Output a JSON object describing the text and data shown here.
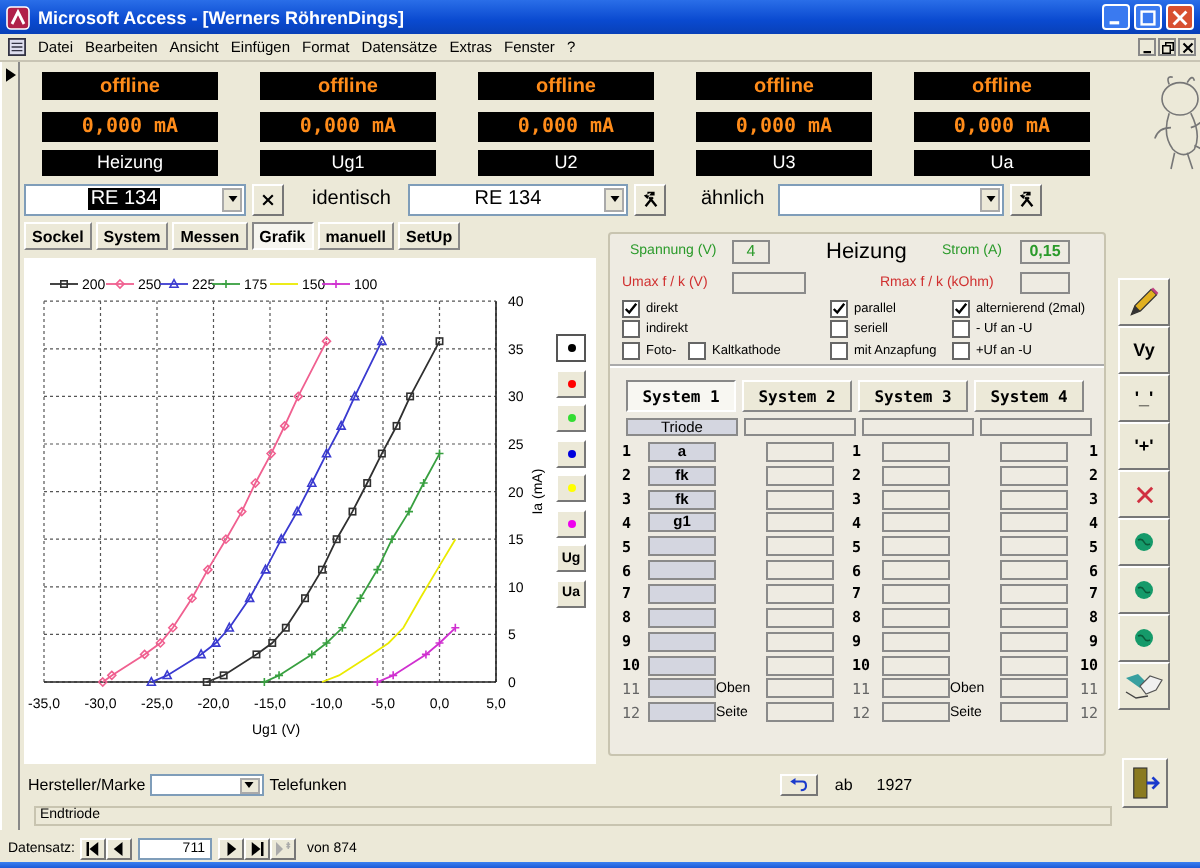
{
  "window": {
    "title": "Microsoft Access - [Werners RöhrenDings]"
  },
  "menu": [
    "Datei",
    "Bearbeiten",
    "Ansicht",
    "Einfügen",
    "Format",
    "Datensätze",
    "Extras",
    "Fenster",
    "?"
  ],
  "meters": [
    {
      "status": "offline",
      "reading": "0,000 mA",
      "label": "Heizung"
    },
    {
      "status": "offline",
      "reading": "0,000 mA",
      "label": "Ug1"
    },
    {
      "status": "offline",
      "reading": "0,000 mA",
      "label": "U2"
    },
    {
      "status": "offline",
      "reading": "0,000 mA",
      "label": "U3"
    },
    {
      "status": "offline",
      "reading": "0,000 mA",
      "label": "Ua"
    }
  ],
  "tube_selector": {
    "value": "RE 134",
    "highlighted": true
  },
  "identical": {
    "label": "identisch",
    "value": "RE 134"
  },
  "similar": {
    "label": "ähnlich"
  },
  "tabs": [
    {
      "label": "Sockel",
      "selected": false
    },
    {
      "label": "System",
      "selected": false
    },
    {
      "label": "Messen",
      "selected": false
    },
    {
      "label": "Grafik",
      "selected": true
    },
    {
      "label": "manuell",
      "selected": false
    },
    {
      "label": "SetUp",
      "selected": false
    }
  ],
  "chart_panel": {
    "chart_data": {
      "type": "line",
      "grid": true,
      "legend": true,
      "xlabel": "Ug1 (V)",
      "ylabel": "Ia (mA)",
      "xlim": [
        -35,
        5
      ],
      "ylim": [
        0,
        40
      ],
      "xticks": [
        {
          "value": -35,
          "label": "-35,0"
        },
        {
          "value": -30,
          "label": "-30,0"
        },
        {
          "value": -25,
          "label": "-25,0"
        },
        {
          "value": -20,
          "label": "-20,0"
        },
        {
          "value": -15,
          "label": "-15,0"
        },
        {
          "value": -10,
          "label": "-10,0"
        },
        {
          "value": -5,
          "label": "-5,0"
        },
        {
          "value": 0,
          "label": "0,0"
        },
        {
          "value": 5,
          "label": "5,0"
        }
      ],
      "yticks": [
        0,
        5,
        10,
        15,
        20,
        25,
        30,
        35,
        40
      ],
      "series": [
        {
          "name": "200",
          "color": "#303030",
          "marker": "square",
          "x": [
            -20.6,
            -19.1,
            -16.2,
            -14.8,
            -13.6,
            -11.9,
            -10.4,
            -9.1,
            -7.7,
            -6.4,
            -5.1,
            -3.8,
            -2.6,
            0
          ],
          "values": [
            0,
            0.7,
            2.9,
            4.1,
            5.7,
            8.8,
            11.8,
            15,
            17.9,
            20.9,
            24,
            26.9,
            30,
            35.8
          ]
        },
        {
          "name": "250",
          "color": "#f06090",
          "marker": "diamond",
          "x": [
            -29.8,
            -29,
            -26.1,
            -24.7,
            -23.6,
            -21.9,
            -20.5,
            -18.9,
            -17.5,
            -16.3,
            -14.9,
            -13.7,
            -12.5,
            -10
          ],
          "values": [
            0,
            0.7,
            2.9,
            4.1,
            5.7,
            8.8,
            11.8,
            15,
            17.9,
            20.9,
            24,
            26.9,
            30,
            35.8
          ]
        },
        {
          "name": "225",
          "color": "#3a3ad0",
          "marker": "triangle",
          "x": [
            -25.5,
            -24.1,
            -21.1,
            -19.8,
            -18.6,
            -16.8,
            -15.4,
            -14,
            -12.6,
            -11.3,
            -10,
            -8.7,
            -7.5,
            -5.1
          ],
          "values": [
            0,
            0.7,
            2.9,
            4.1,
            5.7,
            8.8,
            11.8,
            15,
            17.9,
            20.9,
            24,
            26.9,
            30,
            35.8
          ]
        },
        {
          "name": "175",
          "color": "#38a040",
          "marker": "cross",
          "x": [
            -15.5,
            -14.2,
            -11.3,
            -10,
            -8.6,
            -7,
            -5.5,
            -4.2,
            -2.7,
            -1.4,
            0
          ],
          "values": [
            0,
            0.7,
            2.9,
            4.1,
            5.7,
            8.8,
            11.8,
            15,
            17.9,
            20.9,
            24
          ]
        },
        {
          "name": "150",
          "color": "#eaea00",
          "marker": "none",
          "x": [
            -10.4,
            -8.9,
            -6,
            -4.5,
            -3.2,
            -1.7,
            -0.2,
            1.4
          ],
          "values": [
            0,
            0.7,
            2.9,
            4.1,
            5.7,
            8.8,
            11.8,
            15
          ]
        },
        {
          "name": "100",
          "color": "#d030d0",
          "marker": "cross",
          "x": [
            -5.5,
            -4.1,
            -1.2,
            0,
            1.4
          ],
          "values": [
            0,
            0.7,
            2.9,
            4.1,
            5.7
          ]
        }
      ]
    },
    "color_buttons": [
      {
        "color": "#000000",
        "selected": true
      },
      {
        "color": "#ff0000",
        "selected": false
      },
      {
        "color": "#33dd33",
        "selected": false
      },
      {
        "color": "#0000dd",
        "selected": false
      },
      {
        "color": "#ffff00",
        "selected": false
      },
      {
        "color": "#ee00ee",
        "selected": false
      }
    ],
    "axis_buttons": [
      "Ug",
      "Ua"
    ]
  },
  "heater": {
    "voltage_label": "Spannung (V)",
    "voltage": "4",
    "title": "Heizung",
    "current_label": "Strom (A)",
    "current": "0,15",
    "umax_label": "Umax f / k (V)",
    "rmax_label": "Rmax f / k (kOhm)",
    "option_columns": [
      [
        {
          "label": "direkt",
          "checked": true
        },
        {
          "label": "indirekt",
          "checked": false
        },
        {
          "label": "Foto-",
          "checked": false
        },
        {
          "label": "Kaltkathode",
          "checked": false
        }
      ],
      [
        {
          "label": "parallel",
          "checked": true
        },
        {
          "label": "seriell",
          "checked": false
        },
        {
          "label": "mit Anzapfung",
          "checked": false
        }
      ],
      [
        {
          "label": "alternierend (2mal)",
          "checked": true
        },
        {
          "label": "- Uf an -U",
          "checked": false
        },
        {
          "label": "+Uf an -U",
          "checked": false
        }
      ]
    ]
  },
  "system_tabs": [
    {
      "label": "System 1",
      "selected": true
    },
    {
      "label": "System 2",
      "selected": false
    },
    {
      "label": "System 3",
      "selected": false
    },
    {
      "label": "System 4",
      "selected": false
    }
  ],
  "system_type": "Triode",
  "pin_rows": [
    {
      "kind": "pin",
      "numbers": [
        "1",
        "1",
        "1"
      ],
      "pin": "a"
    },
    {
      "kind": "pin",
      "numbers": [
        "2",
        "2",
        "2"
      ],
      "pin": "fk"
    },
    {
      "kind": "pin",
      "numbers": [
        "3",
        "3",
        "3"
      ],
      "pin": "fk"
    },
    {
      "kind": "pin",
      "numbers": [
        "4",
        "4",
        "4"
      ],
      "pin": "g1"
    },
    {
      "kind": "pin",
      "numbers": [
        "5",
        "5",
        "5"
      ]
    },
    {
      "kind": "pin",
      "numbers": [
        "6",
        "6",
        "6"
      ]
    },
    {
      "kind": "pin",
      "numbers": [
        "7",
        "7",
        "7"
      ]
    },
    {
      "kind": "pin",
      "numbers": [
        "8",
        "8",
        "8"
      ]
    },
    {
      "kind": "pin",
      "numbers": [
        "9",
        "9",
        "9"
      ]
    },
    {
      "kind": "pin",
      "numbers": [
        "10",
        "10",
        "10"
      ]
    },
    {
      "kind": "extra",
      "numbers": [
        "11",
        "11",
        "11"
      ],
      "labels": [
        "Oben",
        "Oben"
      ]
    },
    {
      "kind": "extra",
      "numbers": [
        "12",
        "12",
        "12"
      ],
      "labels": [
        "Seite",
        "Seite"
      ]
    }
  ],
  "side_buttons": [
    {
      "kind": "pencil"
    },
    {
      "kind": "text",
      "label": "Vy"
    },
    {
      "kind": "text",
      "label": "'_'"
    },
    {
      "kind": "text",
      "label": "'+'"
    },
    {
      "kind": "cross"
    },
    {
      "kind": "globe"
    },
    {
      "kind": "globe"
    },
    {
      "kind": "globe"
    },
    {
      "kind": "handshake"
    }
  ],
  "footer": {
    "maker_label": "Hersteller/Marke",
    "maker": "Telefunken",
    "from_label": "ab",
    "year": "1927",
    "description": "Endtriode"
  },
  "navigation": {
    "label": "Datensatz:",
    "record": "711",
    "total": "von 874"
  }
}
